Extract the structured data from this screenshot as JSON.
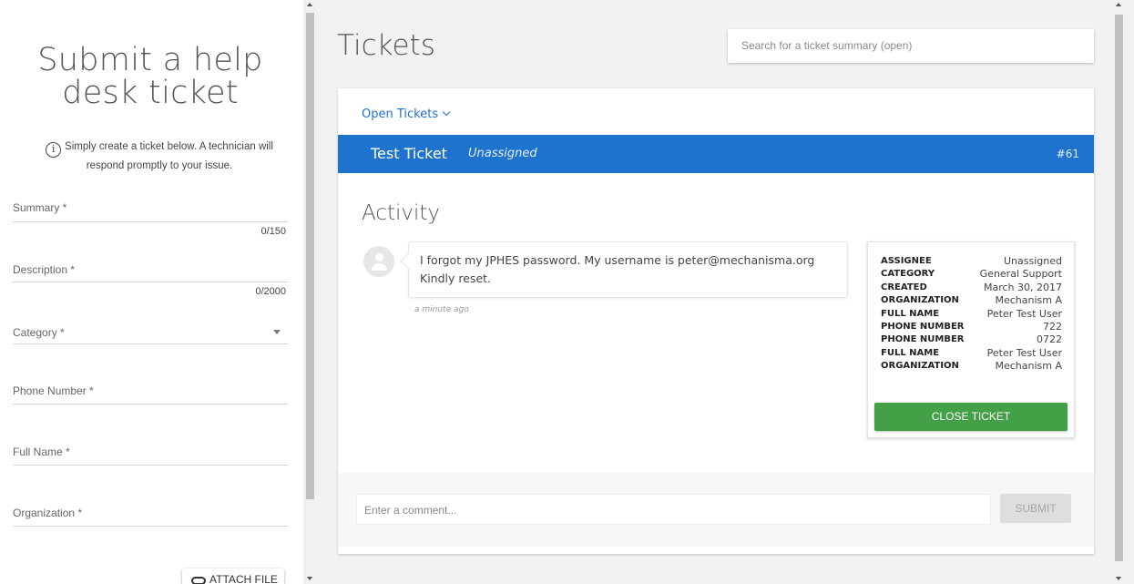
{
  "form": {
    "title": "Submit a help desk ticket",
    "info_text": "Simply create a ticket below. A technician will respond promptly to your issue.",
    "info_icon": "i",
    "fields": {
      "summary": {
        "label": "Summary *",
        "count": "0/150"
      },
      "description": {
        "label": "Description *",
        "count": "0/2000"
      },
      "category": {
        "label": "Category *"
      },
      "phone": {
        "label": "Phone Number *"
      },
      "full_name": {
        "label": "Full Name *"
      },
      "organization": {
        "label": "Organization *"
      }
    },
    "attach_label": "ATTACH FILE"
  },
  "main": {
    "title": "Tickets",
    "search_placeholder": "Search for a ticket summary (open)",
    "filter_label": "Open Tickets",
    "ticket": {
      "name": "Test Ticket",
      "assignee": "Unassigned",
      "number": "#61"
    },
    "activity_title": "Activity",
    "comment": {
      "text": "I forgot my JPHES password. My username is peter@mechanisma.org Kindly reset.",
      "time": "a minute ago"
    },
    "details": [
      {
        "key": "ASSIGNEE",
        "value": "Unassigned"
      },
      {
        "key": "CATEGORY",
        "value": "General Support"
      },
      {
        "key": "CREATED",
        "value": "March 30, 2017"
      },
      {
        "key": "ORGANIZATION",
        "value": "Mechanism A"
      },
      {
        "key": "FULL NAME",
        "value": "Peter Test User"
      },
      {
        "key": "PHONE NUMBER",
        "value": "722"
      },
      {
        "key": "PHONE NUMBER",
        "value": "0722"
      },
      {
        "key": "FULL NAME",
        "value": "Peter Test User"
      },
      {
        "key": "ORGANIZATION",
        "value": "Mechanism A"
      }
    ],
    "close_label": "CLOSE TICKET",
    "comment_placeholder": "Enter a comment...",
    "submit_label": "SUBMIT"
  },
  "colors": {
    "primary": "#1e73cf",
    "success": "#43a047",
    "disabled": "#dedede"
  }
}
